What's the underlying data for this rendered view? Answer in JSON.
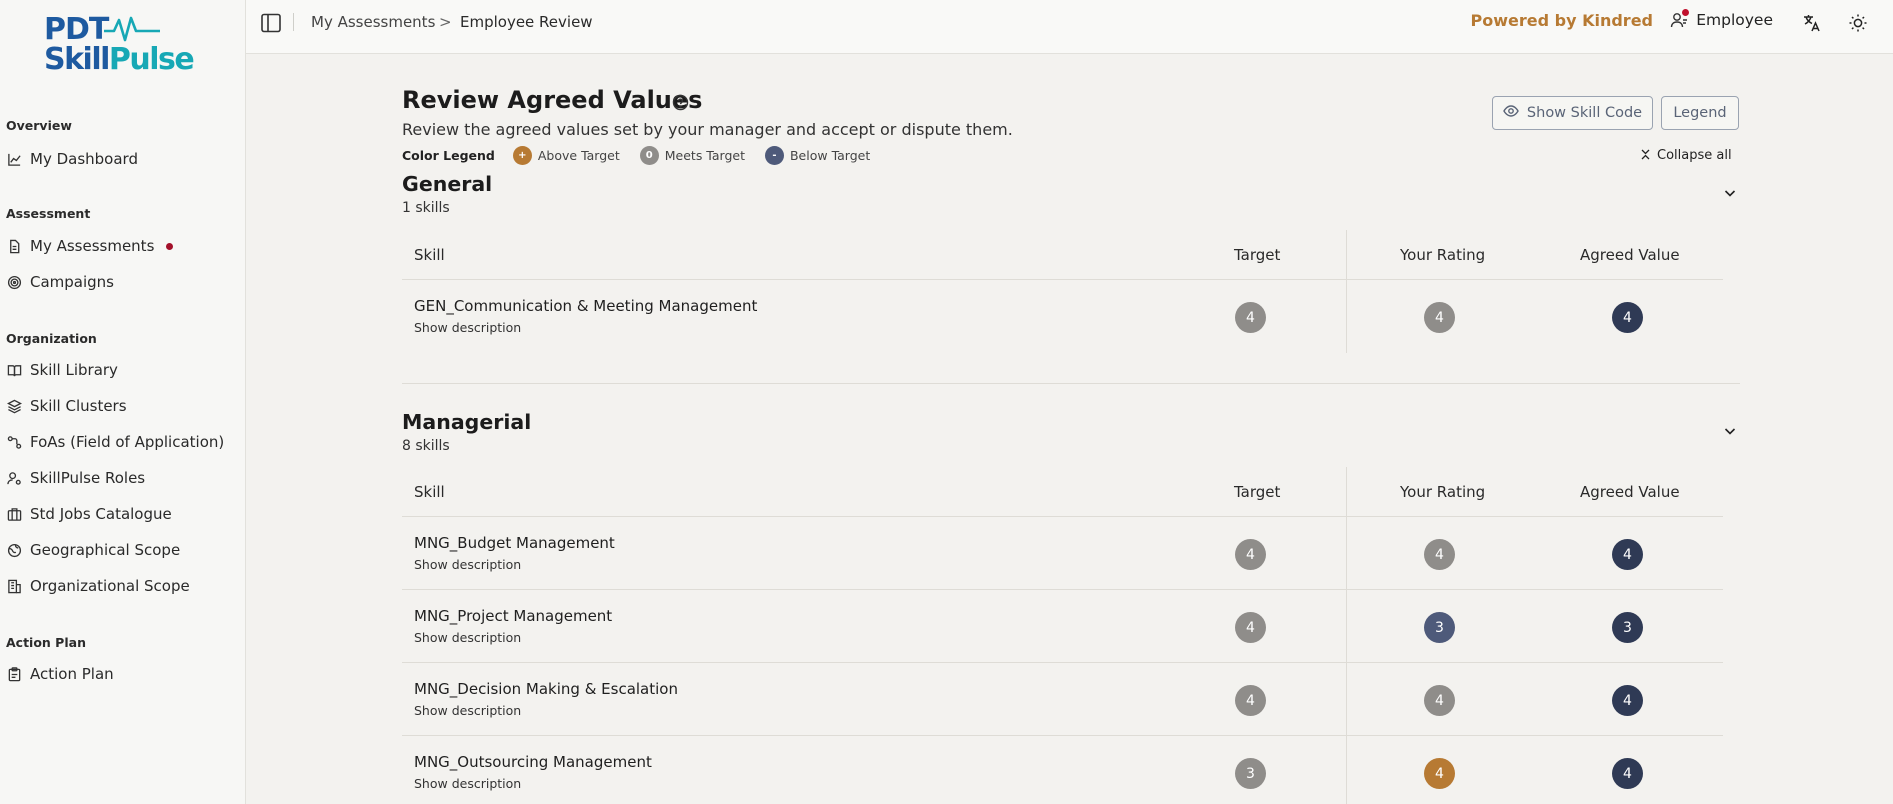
{
  "logo": {
    "line1": "PDT",
    "line2a": "Skill",
    "line2b": "Pulse"
  },
  "colors": {
    "above": "#b77a33",
    "meets": "#8f8d8a",
    "below": "#4e5a7a",
    "agreed": "#2f3a55",
    "accent": "#b77a33"
  },
  "sidebar": {
    "sections": [
      {
        "label": "Overview",
        "items": [
          {
            "label": "My Dashboard",
            "icon": "chart-line-icon"
          }
        ]
      },
      {
        "label": "Assessment",
        "items": [
          {
            "label": "My Assessments",
            "icon": "document-icon",
            "notify": true
          },
          {
            "label": "Campaigns",
            "icon": "target-icon"
          }
        ]
      },
      {
        "label": "Organization",
        "items": [
          {
            "label": "Skill Library",
            "icon": "book-icon"
          },
          {
            "label": "Skill Clusters",
            "icon": "layers-icon"
          },
          {
            "label": "FoAs (Field of Application)",
            "icon": "workflow-icon"
          },
          {
            "label": "SkillPulse Roles",
            "icon": "user-cog-icon"
          },
          {
            "label": "Std Jobs Catalogue",
            "icon": "briefcase-icon"
          },
          {
            "label": "Geographical Scope",
            "icon": "globe-icon"
          },
          {
            "label": "Organizational Scope",
            "icon": "building-icon"
          }
        ]
      },
      {
        "label": "Action Plan",
        "items": [
          {
            "label": "Action Plan",
            "icon": "clipboard-icon"
          }
        ]
      }
    ]
  },
  "topbar": {
    "breadcrumb": [
      "My Assessments",
      "Employee Review"
    ],
    "breadcrumb_sep": ">",
    "powered": "Powered by Kindred",
    "user_role": "Employee"
  },
  "page": {
    "title": "Review Agreed Values",
    "subtitle": "Review the agreed values set by your manager and accept or dispute them.",
    "legend_label": "Color Legend",
    "legend": [
      {
        "symbol": "+",
        "label": "Above Target"
      },
      {
        "symbol": "0",
        "label": "Meets Target"
      },
      {
        "symbol": "-",
        "label": "Below Target"
      }
    ],
    "show_skill_code": "Show Skill Code",
    "legend_button": "Legend",
    "collapse_all": "Collapse all"
  },
  "columns": {
    "skill": "Skill",
    "target": "Target",
    "your_rating": "Your Rating",
    "agreed": "Agreed Value"
  },
  "row_desc_label": "Show description",
  "sections": [
    {
      "title": "General",
      "count": "1 skills",
      "rows": [
        {
          "skill": "GEN_Communication & Meeting Management",
          "target": "4",
          "rating": "4",
          "rating_status": "meets",
          "agreed": "4"
        }
      ]
    },
    {
      "title": "Managerial",
      "count": "8 skills",
      "rows": [
        {
          "skill": "MNG_Budget Management",
          "target": "4",
          "rating": "4",
          "rating_status": "meets",
          "agreed": "4"
        },
        {
          "skill": "MNG_Project Management",
          "target": "4",
          "rating": "3",
          "rating_status": "below",
          "agreed": "3"
        },
        {
          "skill": "MNG_Decision Making & Escalation",
          "target": "4",
          "rating": "4",
          "rating_status": "meets",
          "agreed": "4"
        },
        {
          "skill": "MNG_Outsourcing Management",
          "target": "3",
          "rating": "4",
          "rating_status": "above",
          "agreed": "4"
        }
      ]
    }
  ]
}
